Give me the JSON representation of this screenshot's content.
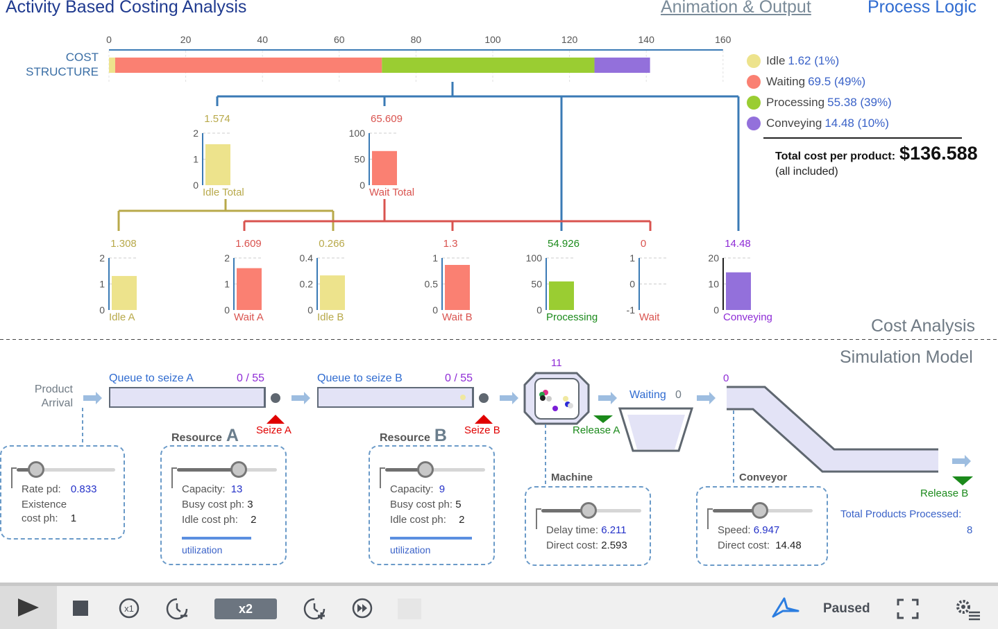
{
  "header": {
    "title": "Activity Based Costing Analysis",
    "animation_link": "Animation & Output",
    "logic_link": "Process Logic"
  },
  "cost_structure": {
    "label_line1": "COST",
    "label_line2": "STRUCTURE",
    "axis_ticks": [
      "0",
      "20",
      "40",
      "60",
      "80",
      "100",
      "120",
      "140",
      "160"
    ],
    "segments": [
      {
        "name": "Idle",
        "value": 1.62,
        "color": "#ede38c"
      },
      {
        "name": "Waiting",
        "value": 69.5,
        "color": "#fa8072"
      },
      {
        "name": "Processing",
        "value": 55.38,
        "color": "#9acd32"
      },
      {
        "name": "Conveying",
        "value": 14.48,
        "color": "#9370db"
      }
    ]
  },
  "legend": [
    {
      "name": "Idle",
      "value": "1.62 (1%)",
      "color": "#ede38c"
    },
    {
      "name": "Waiting",
      "value": "69.5 (49%)",
      "color": "#fa8072"
    },
    {
      "name": "Processing",
      "value": "55.38 (39%)",
      "color": "#9acd32"
    },
    {
      "name": "Conveying",
      "value": "14.48 (10%)",
      "color": "#9370db"
    }
  ],
  "total": {
    "label": "Total cost per product:",
    "value": "$136.588",
    "note": "(all included)"
  },
  "mini_charts": [
    {
      "id": "idle-total",
      "label": "Idle Total",
      "value_text": "1.574",
      "value": 1.574,
      "ticks": [
        "2",
        "1",
        "0"
      ],
      "max": 2,
      "min": 0,
      "color": "#ede38c",
      "text_color": "#b8a94a"
    },
    {
      "id": "wait-total",
      "label": "Wait Total",
      "value_text": "65.609",
      "value": 65.609,
      "ticks": [
        "100",
        "50",
        "0"
      ],
      "max": 100,
      "min": 0,
      "color": "#fa8072",
      "text_color": "#d9534f"
    },
    {
      "id": "idle-a",
      "label": "Idle A",
      "value_text": "1.308",
      "value": 1.308,
      "ticks": [
        "2",
        "1",
        "0"
      ],
      "max": 2,
      "min": 0,
      "color": "#ede38c",
      "text_color": "#b8a94a"
    },
    {
      "id": "wait-a",
      "label": "Wait A",
      "value_text": "1.609",
      "value": 1.609,
      "ticks": [
        "2",
        "1",
        "0"
      ],
      "max": 2,
      "min": 0,
      "color": "#fa8072",
      "text_color": "#d9534f"
    },
    {
      "id": "idle-b",
      "label": "Idle B",
      "value_text": "0.266",
      "value": 0.266,
      "ticks": [
        "0.4",
        "0.2",
        "0"
      ],
      "max": 0.4,
      "min": 0,
      "color": "#ede38c",
      "text_color": "#b8a94a"
    },
    {
      "id": "wait-b",
      "label": "Wait B",
      "value_text": "1.3",
      "value": 1.3,
      "ticks": [
        "1",
        "0.5",
        "0"
      ],
      "max": 1.5,
      "min": 0,
      "color": "#fa8072",
      "text_color": "#d9534f"
    },
    {
      "id": "processing",
      "label": "Processing",
      "value_text": "54.926",
      "value": 54.926,
      "ticks": [
        "100",
        "50",
        "0"
      ],
      "max": 100,
      "min": 0,
      "color": "#9acd32",
      "text_color": "#1b8a1b"
    },
    {
      "id": "wait",
      "label": "Wait",
      "value_text": "0",
      "value": 0,
      "ticks": [
        "1",
        "0",
        "-1"
      ],
      "max": 1,
      "min": -1,
      "color": "#fa8072",
      "text_color": "#d9534f"
    },
    {
      "id": "conveying",
      "label": "Conveying",
      "value_text": "14.48",
      "value": 14.48,
      "ticks": [
        "20",
        "10",
        "0"
      ],
      "max": 20,
      "min": 0,
      "color": "#9370db",
      "text_color": "#8e2bd6"
    }
  ],
  "sections": {
    "cost_analysis": "Cost Analysis",
    "simulation_model": "Simulation Model"
  },
  "simulation": {
    "product_arrival_1": "Product",
    "product_arrival_2": "Arrival",
    "queue_a": {
      "label": "Queue to seize A",
      "count": "0 / 55"
    },
    "queue_b": {
      "label": "Queue to seize B",
      "count": "0 / 55"
    },
    "seize_a": "Seize A",
    "seize_b": "Seize B",
    "machine_count": "11",
    "release_a": "Release A",
    "waiting_label": "Waiting",
    "waiting_count": "0",
    "conveyor_count": "0",
    "release_b": "Release B",
    "total_processed_label": "Total Products Processed:",
    "total_processed_value": "8",
    "arrival_params": {
      "rate_label": "Rate pd:",
      "rate_value": "0.833",
      "existence_label_1": "Existence",
      "existence_label_2": "cost ph:",
      "existence_value": "1",
      "slider_fraction": 0.2
    },
    "resource_a": {
      "title": "Resource",
      "letter": "A",
      "capacity_label": "Capacity:",
      "capacity_value": "13",
      "busy_label": "Busy cost ph:",
      "busy_value": "3",
      "idle_label": "Idle cost ph:",
      "idle_value": "2",
      "utilization_label": "utilization",
      "slider_fraction": 0.62
    },
    "resource_b": {
      "title": "Resource",
      "letter": "B",
      "capacity_label": "Capacity:",
      "capacity_value": "9",
      "busy_label": "Busy cost ph:",
      "busy_value": "5",
      "idle_label": "Idle cost ph:",
      "idle_value": "2",
      "utilization_label": "utilization",
      "slider_fraction": 0.4
    },
    "machine": {
      "title": "Machine",
      "delay_label": "Delay time:",
      "delay_value": "6.211",
      "direct_label": "Direct cost:",
      "direct_value": "2.593",
      "slider_fraction": 0.47
    },
    "conveyor": {
      "title": "Conveyor",
      "speed_label": "Speed:",
      "speed_value": "6.947",
      "direct_label": "Direct cost:",
      "direct_value": "14.48",
      "slider_fraction": 0.47
    }
  },
  "toolbar": {
    "speed_label": "x2",
    "status": "Paused",
    "icons": [
      "play-icon",
      "stop-icon",
      "x1-speed-icon",
      "slow-down-icon",
      "speed-up-icon",
      "fast-forward-icon",
      "anylogic-logo-icon",
      "fullscreen-icon",
      "settings-icon"
    ]
  }
}
